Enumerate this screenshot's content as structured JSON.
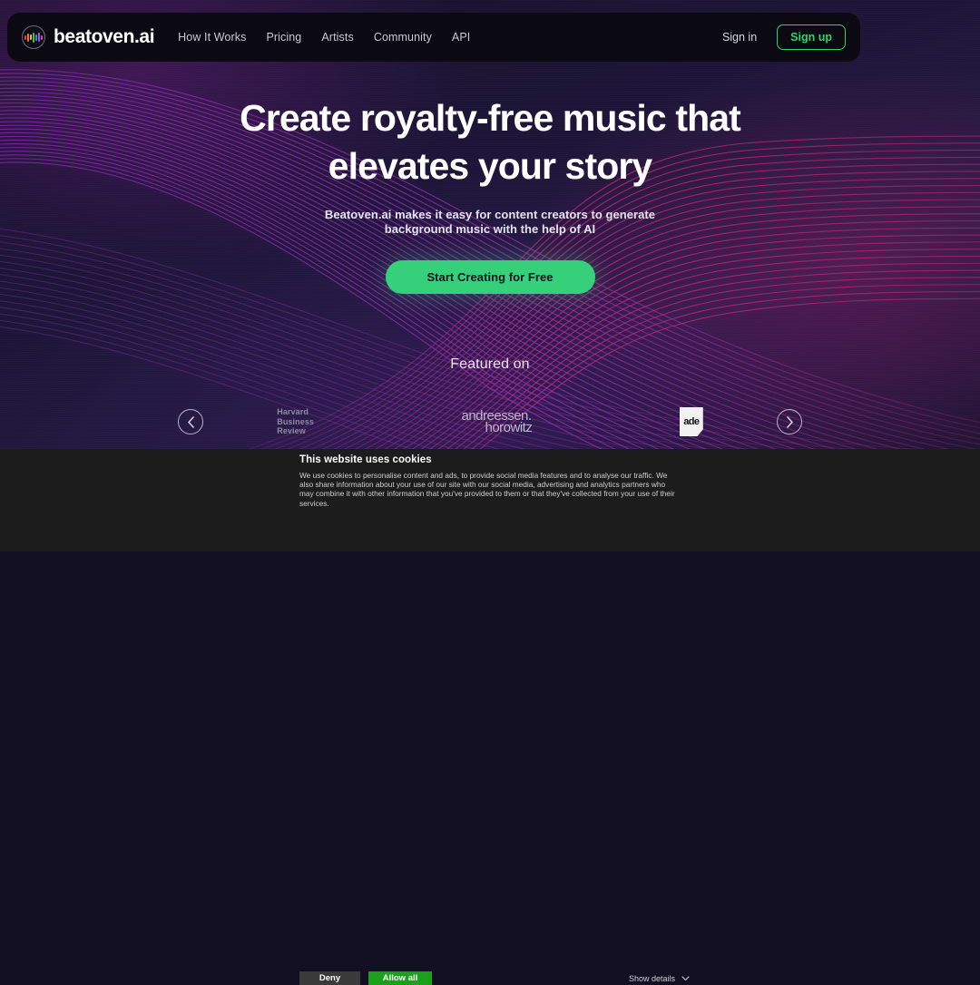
{
  "navbar": {
    "logo_icon": "equalizer-circle-icon",
    "logo_bar_colors": [
      "#e0443a",
      "#e6772f",
      "#e8c62e",
      "#3fbf55",
      "#2f8fe0",
      "#8b5cf6",
      "#e6458f"
    ],
    "brand": "beatoven.ai",
    "links": [
      {
        "label": "How It Works"
      },
      {
        "label": "Pricing"
      },
      {
        "label": "Artists"
      },
      {
        "label": "Community"
      },
      {
        "label": "API"
      }
    ],
    "signin_label": "Sign in",
    "signup_label": "Sign up",
    "accent_green": "#2fd36b"
  },
  "hero": {
    "headline_line1": "Create royalty-free music that",
    "headline_line2": "elevates your story",
    "subhead_line1": "Beatoven.ai makes it easy for content creators to generate",
    "subhead_line2": "background music with the help of AI",
    "cta_label": "Start Creating for Free",
    "cta_color": "#37d07a",
    "background_color": "#1b1436",
    "wave_color_left": "#8e2bb4",
    "wave_color_right": "#c0247e"
  },
  "featured": {
    "title": "Featured on",
    "prev_icon": "chevron-left-icon",
    "next_icon": "chevron-right-icon",
    "logos": [
      {
        "name": "harvard-business-review",
        "line1": "Harvard",
        "line2": "Business",
        "line3": "Review"
      },
      {
        "name": "andreessen-horowitz",
        "line1": "andreessen.",
        "line2": "horowitz"
      },
      {
        "name": "ade",
        "text": "ade"
      }
    ]
  },
  "cookie": {
    "title": "This website uses cookies",
    "body": "We use cookies to personalise content and ads, to provide social media features and to analyse our traffic. We also share information about your use of our site with our social media, advertising and analytics partners who may combine it with other information that you've provided to them or that they've collected from your use of their services.",
    "deny_label": "Deny",
    "allow_label": "Allow all",
    "show_details_label": "Show details",
    "chevron_icon": "chevron-down-icon",
    "allow_color": "#1aa01a"
  }
}
